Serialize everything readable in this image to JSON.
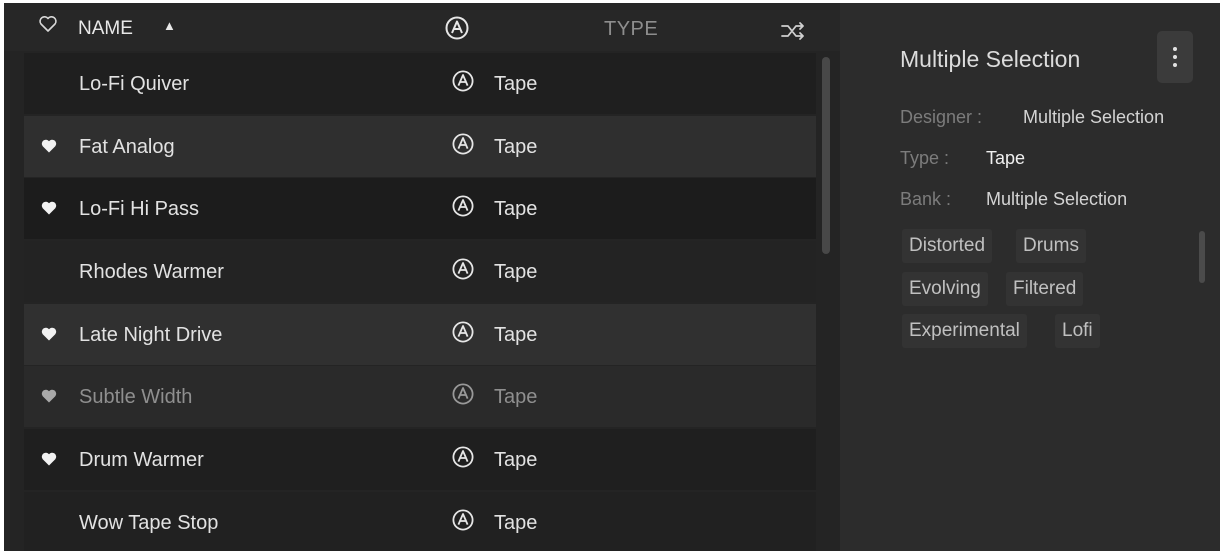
{
  "list": {
    "header": {
      "name_label": "NAME",
      "type_label": "TYPE",
      "sort_direction": "ascending",
      "fav_icon": "heart-outline-icon",
      "type_icon": "arturia-a-icon",
      "shuffle_icon": "shuffle-icon"
    },
    "rows": [
      {
        "name": "Lo-Fi Quiver",
        "type": "Tape",
        "favorite": false,
        "dim": false
      },
      {
        "name": "Fat Analog",
        "type": "Tape",
        "favorite": true,
        "dim": false
      },
      {
        "name": "Lo-Fi Hi Pass",
        "type": "Tape",
        "favorite": true,
        "dim": false
      },
      {
        "name": "Rhodes Warmer",
        "type": "Tape",
        "favorite": false,
        "dim": false
      },
      {
        "name": "Late Night Drive",
        "type": "Tape",
        "favorite": true,
        "dim": false
      },
      {
        "name": "Subtle Width",
        "type": "Tape",
        "favorite": true,
        "dim": true
      },
      {
        "name": "Drum Warmer",
        "type": "Tape",
        "favorite": true,
        "dim": false
      },
      {
        "name": "Wow Tape Stop",
        "type": "Tape",
        "favorite": false,
        "dim": false
      }
    ]
  },
  "detail": {
    "title": "Multiple Selection",
    "menu_icon": "vertical-ellipsis-icon",
    "designer_label": "Designer :",
    "designer_value": "Multiple Selection",
    "type_label": "Type :",
    "type_value": "Tape",
    "bank_label": "Bank :",
    "bank_value": "Multiple Selection",
    "tags": [
      "Distorted",
      "Drums",
      "Evolving",
      "Filtered",
      "Experimental",
      "Lofi"
    ]
  },
  "colors": {
    "background": "#242424",
    "row_light": "#2f2f2f",
    "row_dark": "#1e1e1e",
    "panel": "#2c2c2c",
    "text": "#e2e2e2",
    "text_dim": "#8f8f8f"
  }
}
